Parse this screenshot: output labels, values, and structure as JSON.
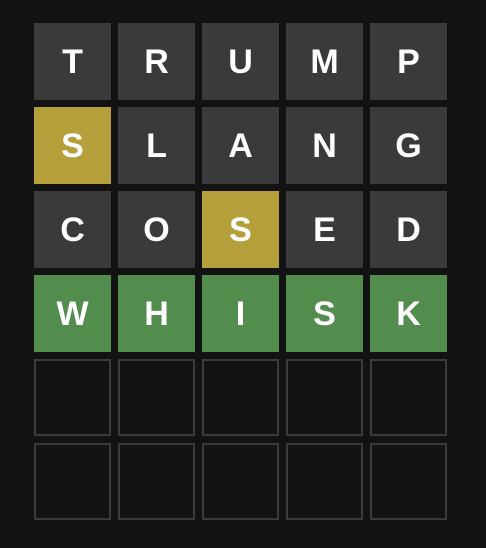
{
  "colors": {
    "background": "#121213",
    "absent": "#3a3a3c",
    "present": "#b59f3b",
    "correct": "#538d4e",
    "empty_border": "#3a3a3c",
    "letter": "#ffffff"
  },
  "board": {
    "rows": [
      {
        "tiles": [
          {
            "letter": "T",
            "state": "absent"
          },
          {
            "letter": "R",
            "state": "absent"
          },
          {
            "letter": "U",
            "state": "absent"
          },
          {
            "letter": "M",
            "state": "absent"
          },
          {
            "letter": "P",
            "state": "absent"
          }
        ]
      },
      {
        "tiles": [
          {
            "letter": "S",
            "state": "present"
          },
          {
            "letter": "L",
            "state": "absent"
          },
          {
            "letter": "A",
            "state": "absent"
          },
          {
            "letter": "N",
            "state": "absent"
          },
          {
            "letter": "G",
            "state": "absent"
          }
        ]
      },
      {
        "tiles": [
          {
            "letter": "C",
            "state": "absent"
          },
          {
            "letter": "O",
            "state": "absent"
          },
          {
            "letter": "S",
            "state": "present"
          },
          {
            "letter": "E",
            "state": "absent"
          },
          {
            "letter": "D",
            "state": "absent"
          }
        ]
      },
      {
        "tiles": [
          {
            "letter": "W",
            "state": "correct"
          },
          {
            "letter": "H",
            "state": "correct"
          },
          {
            "letter": "I",
            "state": "correct"
          },
          {
            "letter": "S",
            "state": "correct"
          },
          {
            "letter": "K",
            "state": "correct"
          }
        ]
      },
      {
        "tiles": [
          {
            "letter": "",
            "state": "empty"
          },
          {
            "letter": "",
            "state": "empty"
          },
          {
            "letter": "",
            "state": "empty"
          },
          {
            "letter": "",
            "state": "empty"
          },
          {
            "letter": "",
            "state": "empty"
          }
        ]
      },
      {
        "tiles": [
          {
            "letter": "",
            "state": "empty"
          },
          {
            "letter": "",
            "state": "empty"
          },
          {
            "letter": "",
            "state": "empty"
          },
          {
            "letter": "",
            "state": "empty"
          },
          {
            "letter": "",
            "state": "empty"
          }
        ]
      }
    ]
  }
}
